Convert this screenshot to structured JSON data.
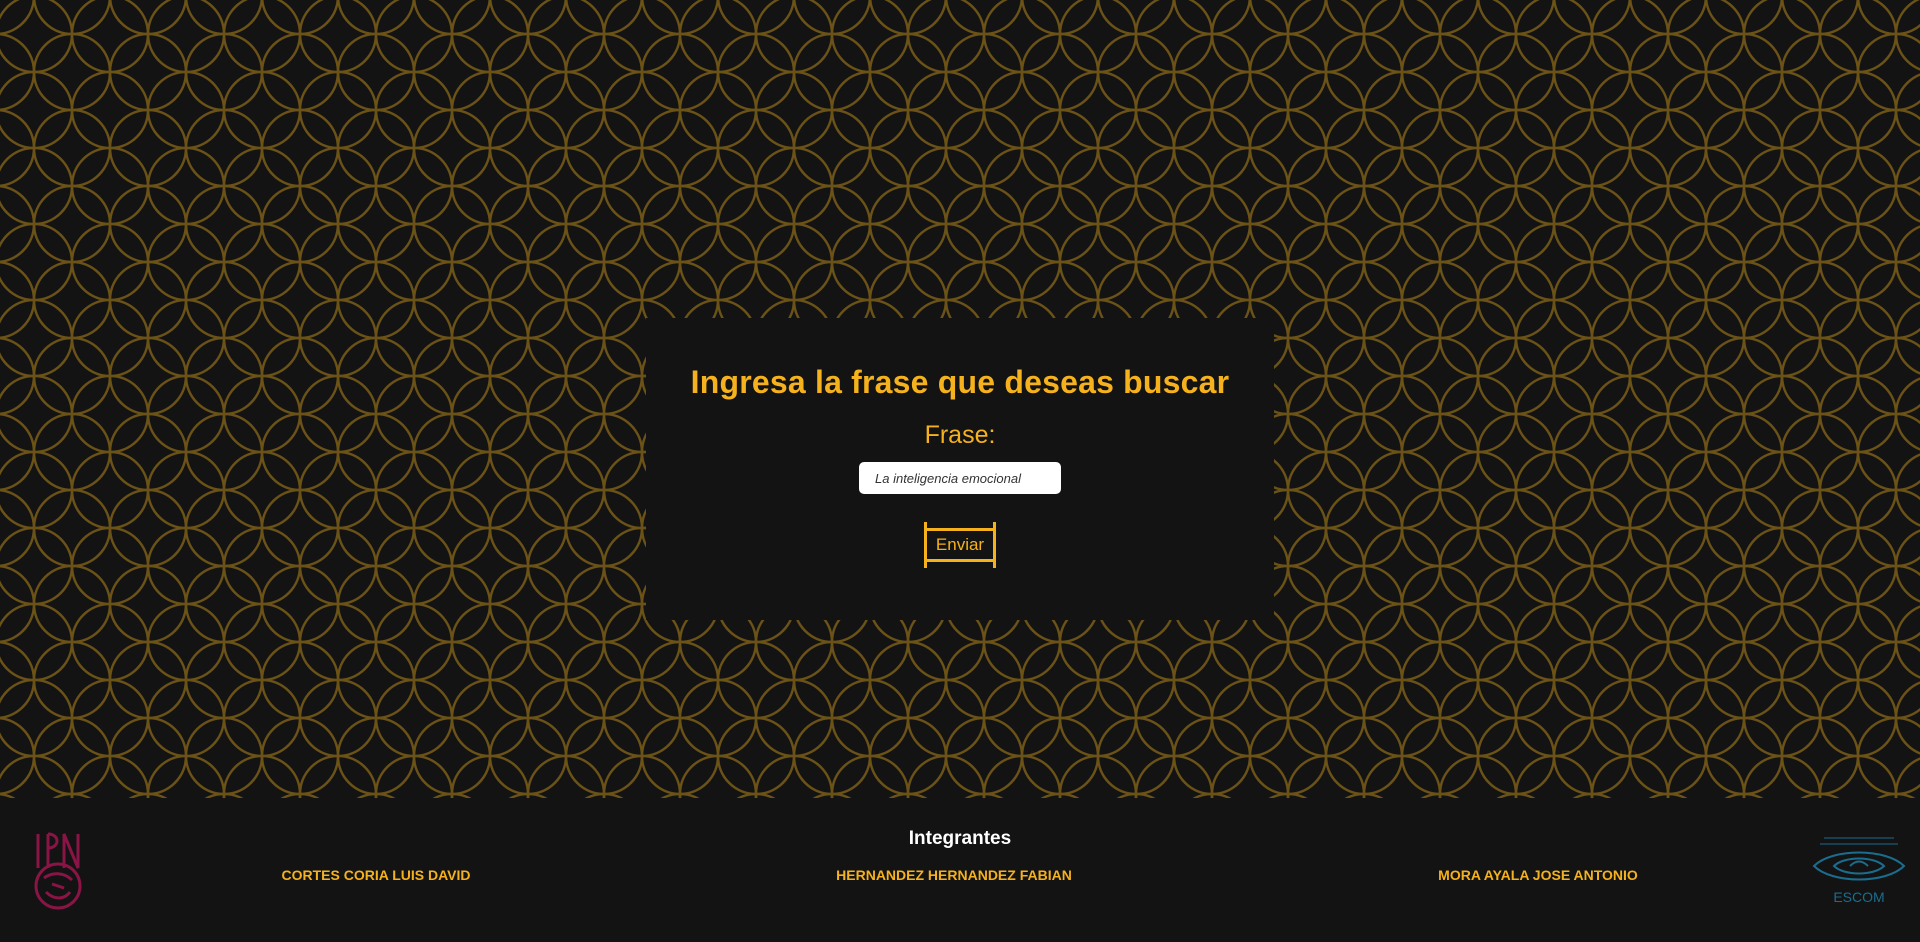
{
  "form": {
    "title": "Ingresa la frase que deseas buscar",
    "label": "Frase:",
    "input_value": "La inteligencia emocional",
    "submit_label": "Enviar"
  },
  "footer": {
    "title": "Integrantes",
    "members": [
      "CORTES CORIA LUIS DAVID",
      "HERNANDEZ HERNANDEZ FABIAN",
      "MORA AYALA JOSE ANTONIO"
    ],
    "logos": {
      "left": "IPN",
      "right": "ESCOM"
    }
  },
  "colors": {
    "accent": "#f6b21d",
    "background": "#131313",
    "pattern": "#6b5217",
    "ipn_logo": "#8a1445",
    "escom_logo": "#1a6d8f"
  }
}
